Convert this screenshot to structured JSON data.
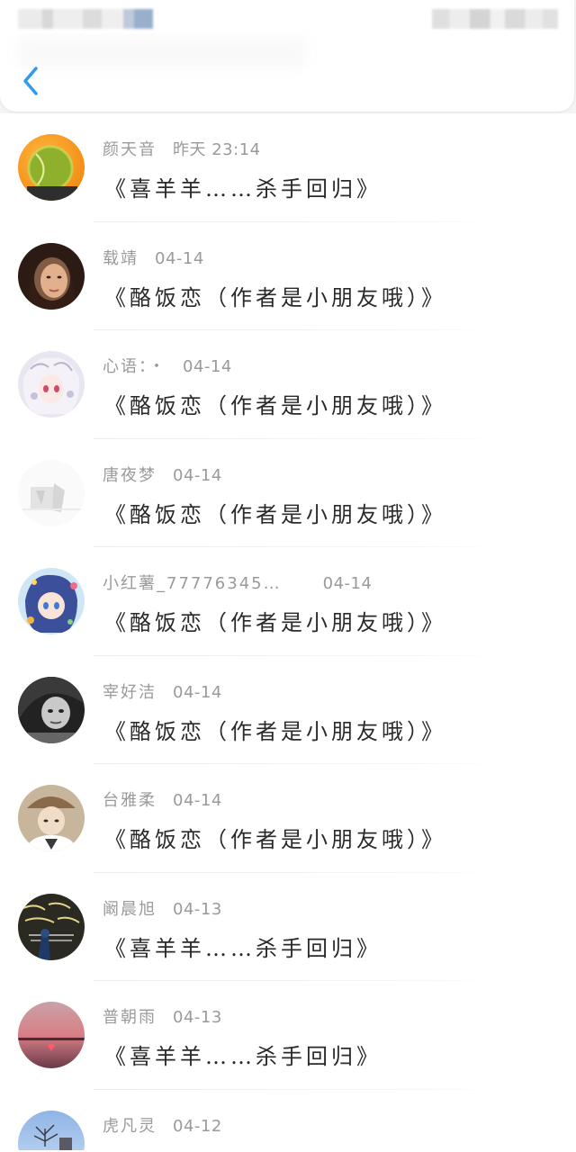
{
  "header": {
    "back_icon": "chevron-left-icon",
    "accent_color": "#2f9bea"
  },
  "messages": [
    {
      "name": "颜天音",
      "time": "昨天 23:14",
      "text": "《喜羊羊……杀手回归》",
      "avatar": "tennis-ball-avatar"
    },
    {
      "name": "载靖",
      "time": "04-14",
      "text": "《酪饭恋（作者是小朋友哦）》",
      "avatar": "girl-photo-avatar"
    },
    {
      "name": "心语：・",
      "time": "04-14",
      "text": "《酪饭恋（作者是小朋友哦）》",
      "avatar": "anime-girl-avatar"
    },
    {
      "name": "唐夜梦",
      "time": "04-14",
      "text": "《酪饭恋（作者是小朋友哦）》",
      "avatar": "white-sketch-avatar"
    },
    {
      "name": "小红薯_77776345…",
      "time": "04-14",
      "text": "《酪饭恋（作者是小朋友哦）》",
      "avatar": "anime-colorful-avatar"
    },
    {
      "name": "宰好洁",
      "time": "04-14",
      "text": "《酪饭恋（作者是小朋友哦）》",
      "avatar": "bw-girl-avatar"
    },
    {
      "name": "台雅柔",
      "time": "04-14",
      "text": "《酪饭恋（作者是小朋友哦）》",
      "avatar": "hat-person-avatar"
    },
    {
      "name": "阚晨旭",
      "time": "04-13",
      "text": "《喜羊羊……杀手回归》",
      "avatar": "chalk-wall-avatar"
    },
    {
      "name": "普朝雨",
      "time": "04-13",
      "text": "《喜羊羊……杀手回归》",
      "avatar": "sunset-heart-avatar"
    },
    {
      "name": "虎凡灵",
      "time": "04-12",
      "text": "",
      "avatar": "winter-tree-avatar"
    }
  ]
}
